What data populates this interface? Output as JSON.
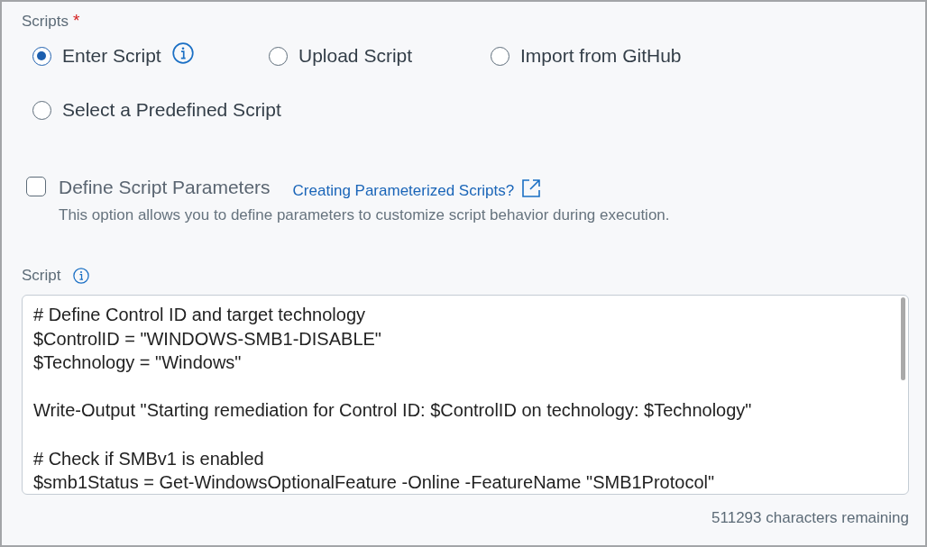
{
  "scripts_label": {
    "text": "Scripts",
    "required_mark": "*"
  },
  "source_options": [
    {
      "label": "Enter Script",
      "selected": true,
      "info": true
    },
    {
      "label": "Upload Script",
      "selected": false,
      "info": false
    },
    {
      "label": "Import from GitHub",
      "selected": false,
      "info": false
    },
    {
      "label": "Select a Predefined Script",
      "selected": false,
      "info": false
    }
  ],
  "parameters_option": {
    "label": "Define Script Parameters",
    "checked": false,
    "link": "Creating Parameterized Scripts?",
    "description": "This option allows you to define parameters to customize script behavior during execution."
  },
  "script_field": {
    "label": "Script",
    "blocks": [
      [
        "# Define Control ID and target technology",
        "$ControlID = \"WINDOWS-SMB1-DISABLE\"",
        "$Technology = \"Windows\""
      ],
      [
        "Write-Output \"Starting remediation for Control ID: $ControlID on technology: $Technology\""
      ],
      [
        "# Check if SMBv1 is enabled",
        "$smb1Status = Get-WindowsOptionalFeature -Online -FeatureName \"SMB1Protocol\""
      ]
    ],
    "remaining": "511293 characters remaining"
  }
}
